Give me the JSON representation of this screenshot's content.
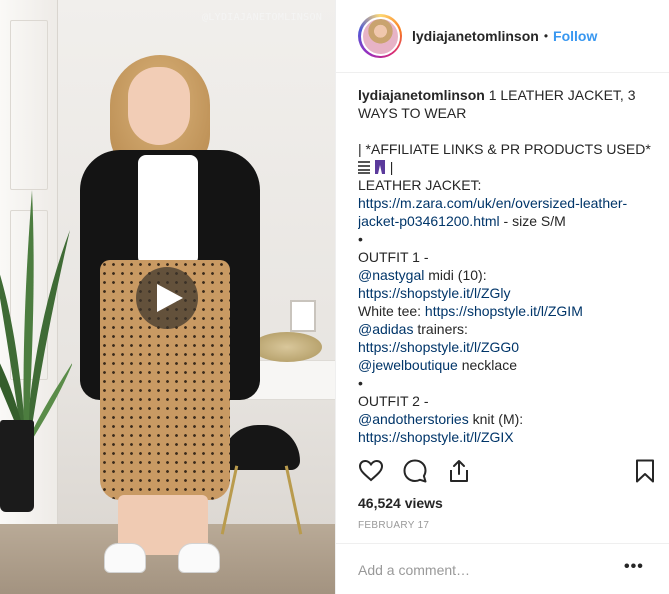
{
  "media": {
    "watermark": "@LYDIAJANETOMLINSON"
  },
  "header": {
    "username": "lydiajanetomlinson",
    "separator": "•",
    "follow_label": "Follow"
  },
  "caption": {
    "author": "lydiajanetomlinson",
    "title": " 1 LEATHER JACKET, 3 WAYS TO WEAR",
    "affiliate_note": "| *AFFILIATE LINKS & PR PRODUCTS USED*",
    "affiliate_end": " |",
    "leather_jacket_label": "LEATHER JACKET:",
    "leather_jacket_link": "https://m.zara.com/uk/en/oversized-leather-jacket-p03461200.html",
    "leather_jacket_size": " - size S/M",
    "bullet": "•",
    "outfit1_label": "OUTFIT 1 -",
    "nastygal_handle": "@nastygal",
    "nastygal_text": " midi (10):",
    "nastygal_link": "https://shopstyle.it/l/ZGly",
    "white_tee_text": "White tee: ",
    "white_tee_link": "https://shopstyle.it/l/ZGIM",
    "adidas_handle": "@adidas",
    "adidas_text": " trainers:",
    "adidas_link": "https://shopstyle.it/l/ZGG0",
    "jewel_handle": "@jewelboutique",
    "jewel_text": " necklace",
    "outfit2_label": "OUTFIT 2 -",
    "andother_handle": "@andotherstories",
    "andother_text": " knit (M):",
    "andother_link": "https://shopstyle.it/l/ZGIX"
  },
  "actions": {
    "like_icon": "heart-icon",
    "comment_icon": "comment-icon",
    "share_icon": "share-icon",
    "save_icon": "bookmark-icon"
  },
  "views": "46,524 views",
  "date": "FEBRUARY 17",
  "comment": {
    "placeholder": "Add a comment…",
    "more_label": "•••"
  },
  "colors": {
    "link_blue": "#3897f0",
    "link_dark": "#003569",
    "text": "#262626",
    "muted": "#999999"
  }
}
